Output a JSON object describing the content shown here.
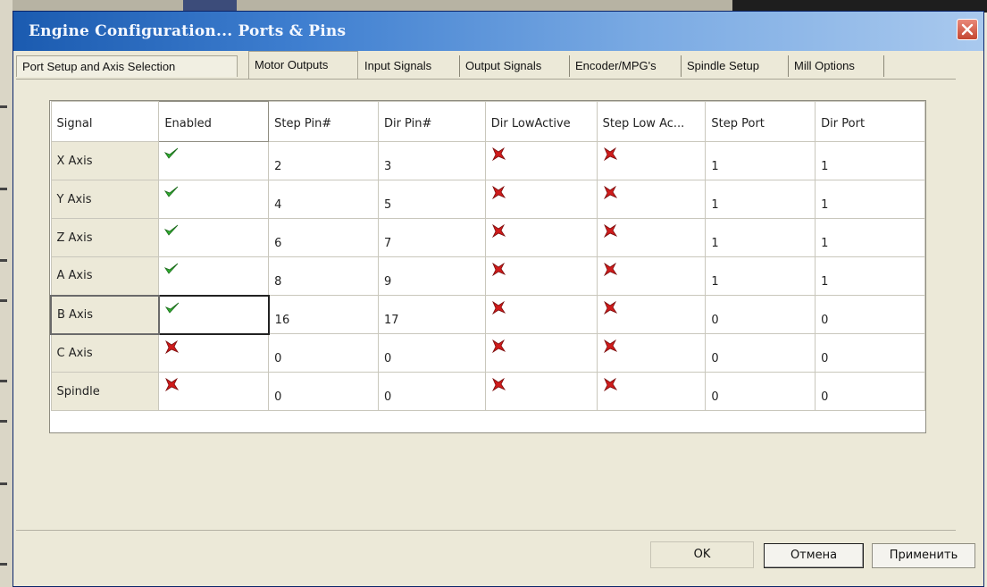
{
  "window": {
    "title": "Engine Configuration... Ports & Pins"
  },
  "tabs": [
    {
      "label": "Port Setup and Axis Selection",
      "active": false
    },
    {
      "label": "Motor Outputs",
      "active": true
    },
    {
      "label": "Input Signals",
      "active": false
    },
    {
      "label": "Output Signals",
      "active": false
    },
    {
      "label": "Encoder/MPG's",
      "active": false
    },
    {
      "label": "Spindle Setup",
      "active": false
    },
    {
      "label": "Mill Options",
      "active": false
    }
  ],
  "grid": {
    "columns": [
      "Signal",
      "Enabled",
      "Step Pin#",
      "Dir Pin#",
      "Dir LowActive",
      "Step Low Ac...",
      "Step Port",
      "Dir Port"
    ],
    "rows": [
      {
        "signal": "X Axis",
        "enabled": true,
        "step_pin": "2",
        "dir_pin": "3",
        "dir_low_active": false,
        "step_low_active": false,
        "step_port": "1",
        "dir_port": "1"
      },
      {
        "signal": "Y Axis",
        "enabled": true,
        "step_pin": "4",
        "dir_pin": "5",
        "dir_low_active": false,
        "step_low_active": false,
        "step_port": "1",
        "dir_port": "1"
      },
      {
        "signal": "Z Axis",
        "enabled": true,
        "step_pin": "6",
        "dir_pin": "7",
        "dir_low_active": false,
        "step_low_active": false,
        "step_port": "1",
        "dir_port": "1"
      },
      {
        "signal": "A Axis",
        "enabled": true,
        "step_pin": "8",
        "dir_pin": "9",
        "dir_low_active": false,
        "step_low_active": false,
        "step_port": "1",
        "dir_port": "1"
      },
      {
        "signal": "B Axis",
        "enabled": true,
        "step_pin": "16",
        "dir_pin": "17",
        "dir_low_active": false,
        "step_low_active": false,
        "step_port": "0",
        "dir_port": "0"
      },
      {
        "signal": "C Axis",
        "enabled": false,
        "step_pin": "0",
        "dir_pin": "0",
        "dir_low_active": false,
        "step_low_active": false,
        "step_port": "0",
        "dir_port": "0"
      },
      {
        "signal": "Spindle",
        "enabled": false,
        "step_pin": "0",
        "dir_pin": "0",
        "dir_low_active": false,
        "step_low_active": false,
        "step_port": "0",
        "dir_port": "0"
      }
    ]
  },
  "buttons": {
    "ok": "OK",
    "cancel": "Отмена",
    "apply": "Применить"
  },
  "colors": {
    "check": "#2fae2f",
    "cross": "#d01b1b",
    "title_bar": "#2a66c0"
  },
  "icons": {
    "enabled_true": "green-check-icon",
    "enabled_false": "red-x-icon",
    "close": "close-icon"
  }
}
